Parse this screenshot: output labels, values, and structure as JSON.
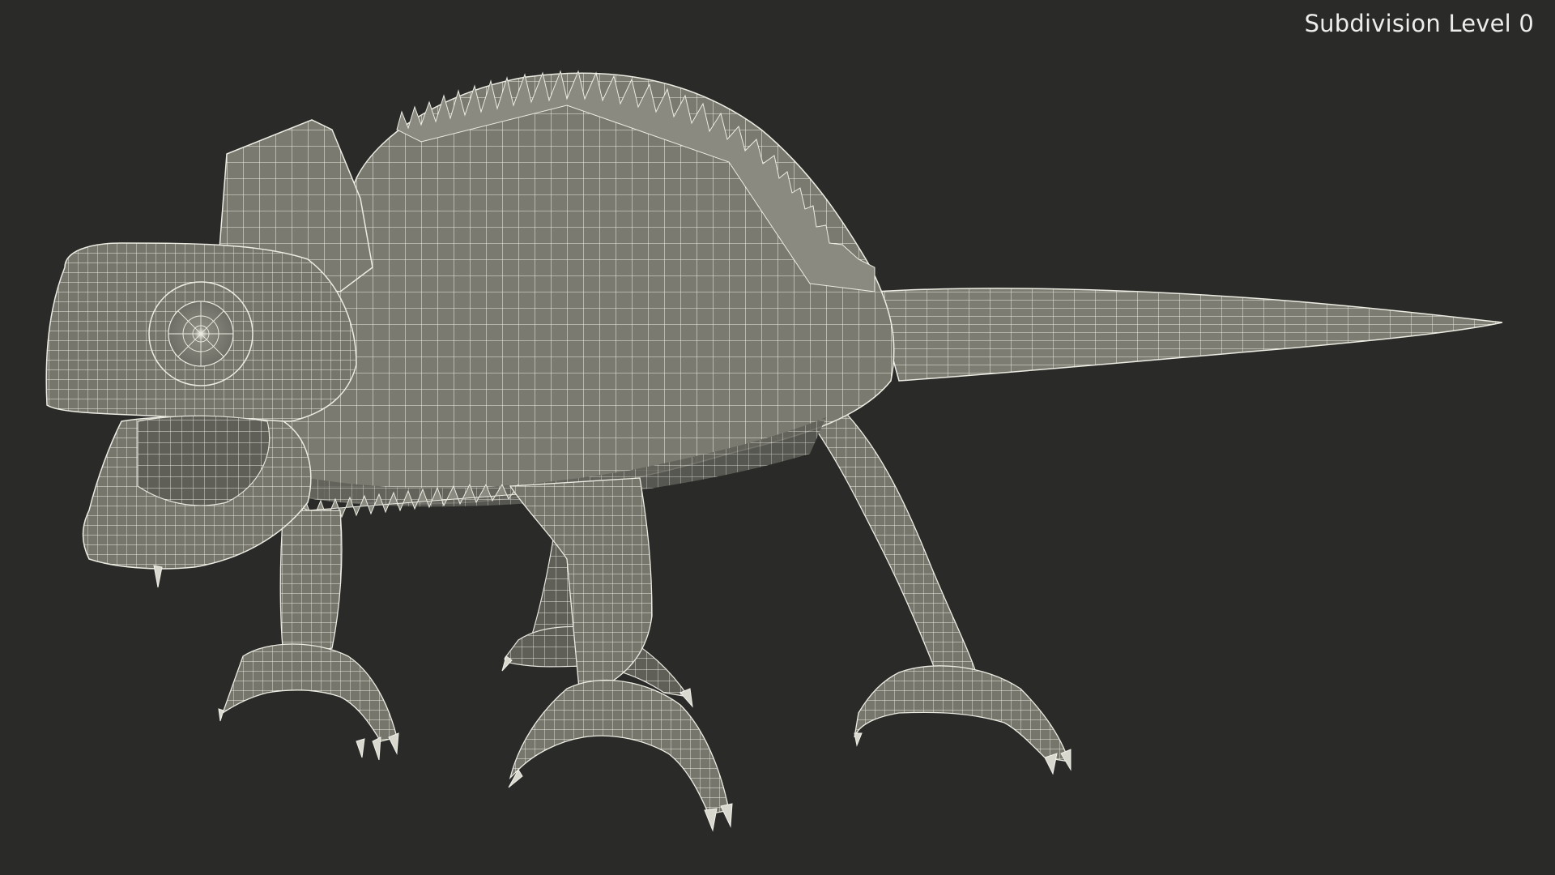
{
  "viewport": {
    "overlay_label": "Subdivision Level 0"
  },
  "scene": {
    "subject": "chameleon-wireframe-model",
    "colors": {
      "background": "#2a2a29",
      "mesh_fill": "#7a7a70",
      "mesh_fill_shadow": "#5e5e57",
      "wire": "#f2f2ea",
      "label_text": "#ededea"
    }
  }
}
